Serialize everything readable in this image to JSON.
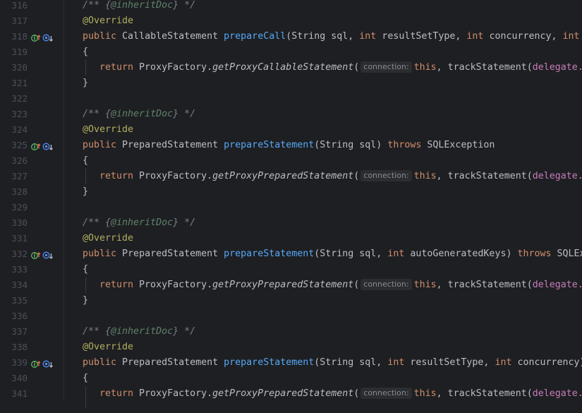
{
  "gutter_icon_names": [
    "implements-method-icon",
    "find-usages-icon"
  ],
  "lines": [
    {
      "n": "316",
      "indent": 0,
      "segments": [
        {
          "c": "cmt",
          "t": "/** {"
        },
        {
          "c": "tag",
          "t": "@inheritDoc"
        },
        {
          "c": "cmt",
          "t": "} */"
        }
      ]
    },
    {
      "n": "317",
      "indent": 0,
      "segments": [
        {
          "c": "ann",
          "t": "@Override"
        }
      ]
    },
    {
      "n": "318",
      "indent": 0,
      "icons": true,
      "segments": [
        {
          "c": "kw",
          "t": "public "
        },
        {
          "c": "",
          "t": "CallableStatement "
        },
        {
          "c": "decl",
          "t": "prepareCall"
        },
        {
          "c": "",
          "t": "(String sql, "
        },
        {
          "c": "kw",
          "t": "int "
        },
        {
          "c": "",
          "t": "resultSetType, "
        },
        {
          "c": "kw",
          "t": "int "
        },
        {
          "c": "",
          "t": "concurrency, "
        },
        {
          "c": "kw",
          "t": "int "
        }
      ]
    },
    {
      "n": "319",
      "indent": 0,
      "segments": [
        {
          "c": "",
          "t": "{"
        }
      ]
    },
    {
      "n": "320",
      "indent": 1,
      "segments": [
        {
          "c": "kw",
          "t": "return "
        },
        {
          "c": "",
          "t": "ProxyFactory."
        },
        {
          "c": "static",
          "t": "getProxyCallableStatement"
        },
        {
          "c": "",
          "t": "("
        },
        {
          "c": "hint",
          "t": "connection:"
        },
        {
          "c": "kw",
          "t": "this"
        },
        {
          "c": "",
          "t": ", trackStatement("
        },
        {
          "c": "fld",
          "t": "delegate."
        }
      ]
    },
    {
      "n": "321",
      "indent": 0,
      "segments": [
        {
          "c": "",
          "t": "}"
        }
      ]
    },
    {
      "n": "322",
      "indent": 0,
      "segments": []
    },
    {
      "n": "323",
      "indent": 0,
      "segments": [
        {
          "c": "cmt",
          "t": "/** {"
        },
        {
          "c": "tag",
          "t": "@inheritDoc"
        },
        {
          "c": "cmt",
          "t": "} */"
        }
      ]
    },
    {
      "n": "324",
      "indent": 0,
      "segments": [
        {
          "c": "ann",
          "t": "@Override"
        }
      ]
    },
    {
      "n": "325",
      "indent": 0,
      "icons": true,
      "segments": [
        {
          "c": "kw",
          "t": "public "
        },
        {
          "c": "",
          "t": "PreparedStatement "
        },
        {
          "c": "decl",
          "t": "prepareStatement"
        },
        {
          "c": "",
          "t": "(String sql) "
        },
        {
          "c": "kw",
          "t": "throws "
        },
        {
          "c": "",
          "t": "SQLException"
        }
      ]
    },
    {
      "n": "326",
      "indent": 0,
      "segments": [
        {
          "c": "",
          "t": "{"
        }
      ]
    },
    {
      "n": "327",
      "indent": 1,
      "segments": [
        {
          "c": "kw",
          "t": "return "
        },
        {
          "c": "",
          "t": "ProxyFactory."
        },
        {
          "c": "static",
          "t": "getProxyPreparedStatement"
        },
        {
          "c": "",
          "t": "("
        },
        {
          "c": "hint",
          "t": "connection:"
        },
        {
          "c": "kw",
          "t": "this"
        },
        {
          "c": "",
          "t": ", trackStatement("
        },
        {
          "c": "fld",
          "t": "delegate."
        }
      ]
    },
    {
      "n": "328",
      "indent": 0,
      "segments": [
        {
          "c": "",
          "t": "}"
        }
      ]
    },
    {
      "n": "329",
      "indent": 0,
      "segments": []
    },
    {
      "n": "330",
      "indent": 0,
      "segments": [
        {
          "c": "cmt",
          "t": "/** {"
        },
        {
          "c": "tag",
          "t": "@inheritDoc"
        },
        {
          "c": "cmt",
          "t": "} */"
        }
      ]
    },
    {
      "n": "331",
      "indent": 0,
      "segments": [
        {
          "c": "ann",
          "t": "@Override"
        }
      ]
    },
    {
      "n": "332",
      "indent": 0,
      "icons": true,
      "segments": [
        {
          "c": "kw",
          "t": "public "
        },
        {
          "c": "",
          "t": "PreparedStatement "
        },
        {
          "c": "decl",
          "t": "prepareStatement"
        },
        {
          "c": "",
          "t": "(String sql, "
        },
        {
          "c": "kw",
          "t": "int "
        },
        {
          "c": "",
          "t": "autoGeneratedKeys) "
        },
        {
          "c": "kw",
          "t": "throws "
        },
        {
          "c": "",
          "t": "SQLEx"
        }
      ]
    },
    {
      "n": "333",
      "indent": 0,
      "segments": [
        {
          "c": "",
          "t": "{"
        }
      ]
    },
    {
      "n": "334",
      "indent": 1,
      "segments": [
        {
          "c": "kw",
          "t": "return "
        },
        {
          "c": "",
          "t": "ProxyFactory."
        },
        {
          "c": "static",
          "t": "getProxyPreparedStatement"
        },
        {
          "c": "",
          "t": "("
        },
        {
          "c": "hint",
          "t": "connection:"
        },
        {
          "c": "kw",
          "t": "this"
        },
        {
          "c": "",
          "t": ", trackStatement("
        },
        {
          "c": "fld",
          "t": "delegate."
        }
      ]
    },
    {
      "n": "335",
      "indent": 0,
      "segments": [
        {
          "c": "",
          "t": "}"
        }
      ]
    },
    {
      "n": "336",
      "indent": 0,
      "segments": []
    },
    {
      "n": "337",
      "indent": 0,
      "segments": [
        {
          "c": "cmt",
          "t": "/** {"
        },
        {
          "c": "tag",
          "t": "@inheritDoc"
        },
        {
          "c": "cmt",
          "t": "} */"
        }
      ]
    },
    {
      "n": "338",
      "indent": 0,
      "segments": [
        {
          "c": "ann",
          "t": "@Override"
        }
      ]
    },
    {
      "n": "339",
      "indent": 0,
      "icons": true,
      "segments": [
        {
          "c": "kw",
          "t": "public "
        },
        {
          "c": "",
          "t": "PreparedStatement "
        },
        {
          "c": "decl",
          "t": "prepareStatement"
        },
        {
          "c": "",
          "t": "(String sql, "
        },
        {
          "c": "kw",
          "t": "int "
        },
        {
          "c": "",
          "t": "resultSetType, "
        },
        {
          "c": "kw",
          "t": "int "
        },
        {
          "c": "",
          "t": "concurrency)"
        }
      ]
    },
    {
      "n": "340",
      "indent": 0,
      "segments": [
        {
          "c": "",
          "t": "{"
        }
      ]
    },
    {
      "n": "341",
      "indent": 1,
      "segments": [
        {
          "c": "kw",
          "t": "return "
        },
        {
          "c": "",
          "t": "ProxyFactory."
        },
        {
          "c": "static",
          "t": "getProxyPreparedStatement"
        },
        {
          "c": "",
          "t": "("
        },
        {
          "c": "hint",
          "t": "connection:"
        },
        {
          "c": "kw",
          "t": "this"
        },
        {
          "c": "",
          "t": ", trackStatement("
        },
        {
          "c": "fld",
          "t": "delegate."
        }
      ]
    }
  ]
}
